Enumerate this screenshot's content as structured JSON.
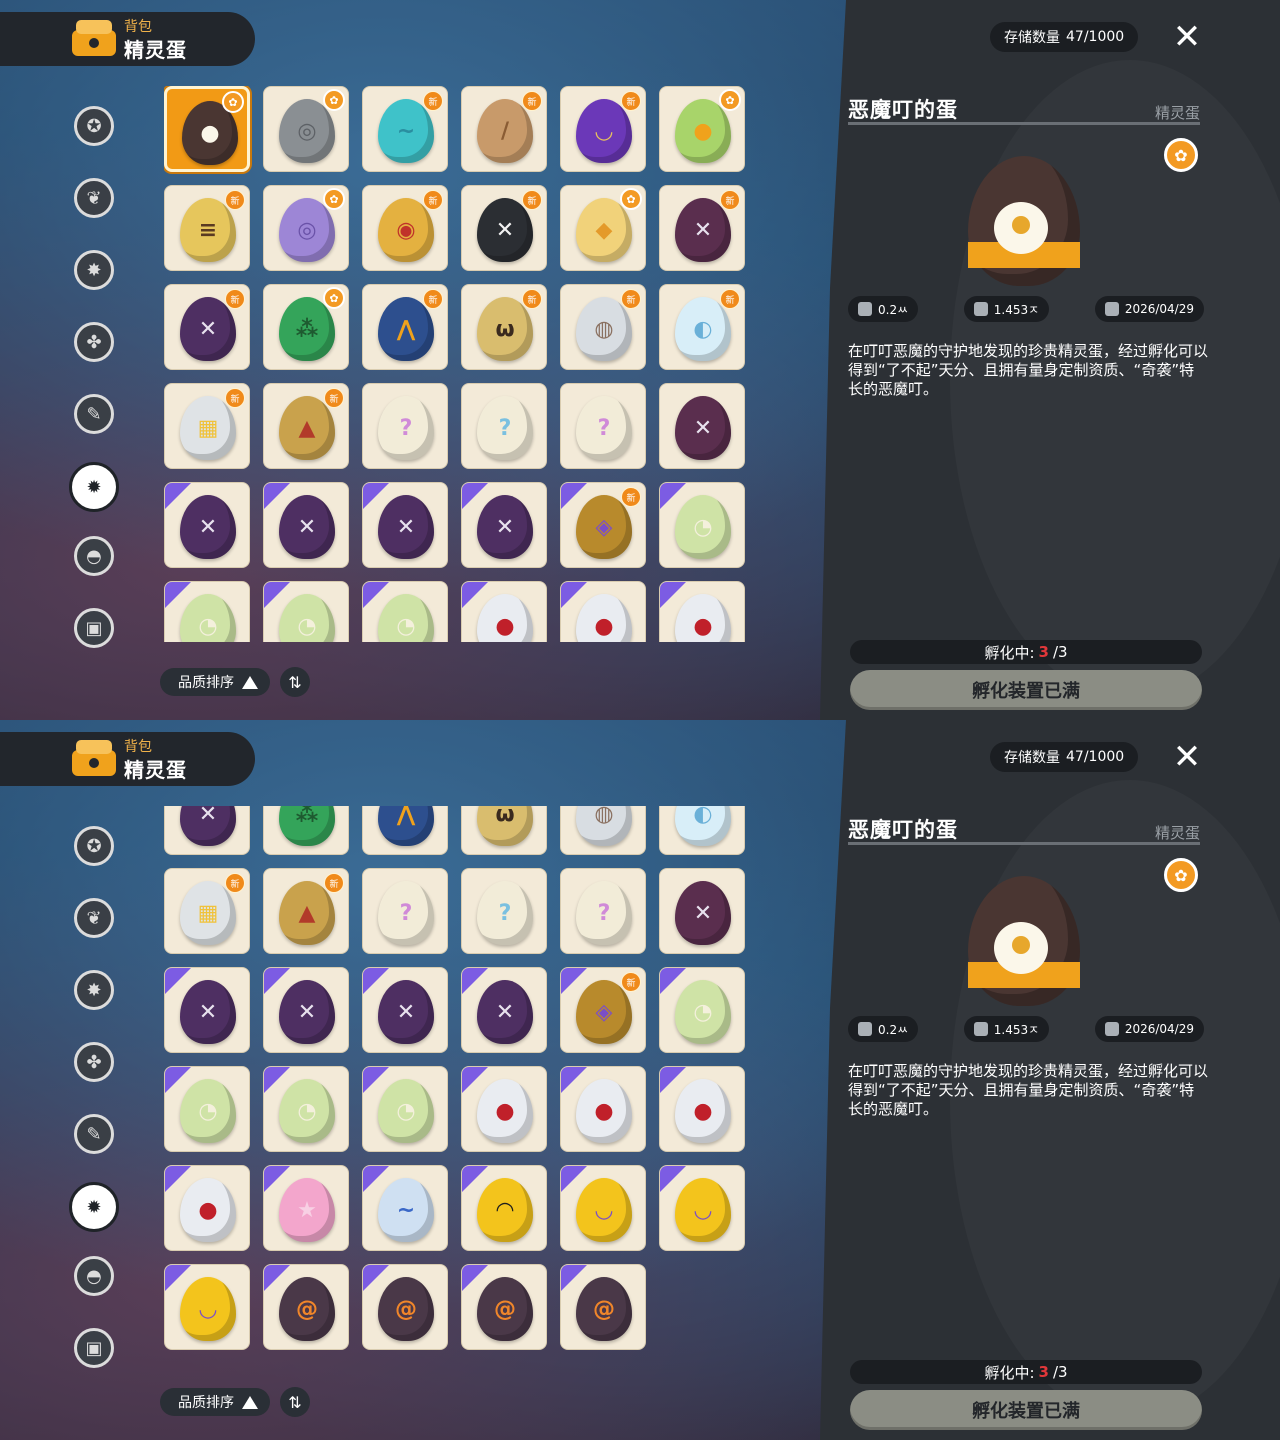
{
  "header": {
    "subtitle": "背包",
    "title": "精灵蛋"
  },
  "sidebar": {
    "icons": [
      "star-icon",
      "leaf-icon",
      "sparkle-icon",
      "bush-icon",
      "document-icon",
      "egg-category-icon",
      "acorn-icon",
      "sofa-icon"
    ],
    "active_index": 5
  },
  "sort": {
    "label": "品质排序",
    "toggle_icon": "⇅"
  },
  "storage": {
    "label": "存储数量",
    "value": "47/1000"
  },
  "detail": {
    "name": "恶魔叮的蛋",
    "category": "精灵蛋",
    "stats": {
      "size": "0.2ㅆ",
      "weight": "1.453ㅈ",
      "date": "2026/04/29"
    },
    "description": "在叮叮恶魔的守护地发现的珍贵精灵蛋，经过孵化可以得到“了不起”天分、且拥有量身定制资质、“奇袭”特长的恶魔叮。",
    "hatching_label": "孵化中:",
    "hatching_current": "3",
    "hatching_total": "/3",
    "hatch_button": "孵化装置已满"
  },
  "badges": {
    "new": "新"
  },
  "colors": {
    "accent": "#f29a15",
    "panel": "#2c3035",
    "card": "#f3ead8",
    "purple_corner": "#7c5ce3",
    "hatch_count": "#e0373a"
  },
  "eggs": [
    {
      "c": "#4a3632",
      "m": "●",
      "mc": "#fbf7ea",
      "badge": "medal",
      "selected": true
    },
    {
      "c": "#8a8f93",
      "m": "◎",
      "mc": "#5d6166",
      "badge": "medal"
    },
    {
      "c": "#3fc2c9",
      "m": "~",
      "mc": "#2a8ea0",
      "badge": "new"
    },
    {
      "c": "#c89a6a",
      "m": "/",
      "mc": "#8a5c34",
      "badge": "new"
    },
    {
      "c": "#6b38b8",
      "m": "◡",
      "mc": "#e8c35c",
      "badge": "new"
    },
    {
      "c": "#a8d46a",
      "m": "●",
      "mc": "#f0a21c",
      "badge": "medal"
    },
    {
      "c": "#e6c65c",
      "m": "≡",
      "mc": "#5a3a22",
      "badge": "new"
    },
    {
      "c": "#9d86d6",
      "m": "◎",
      "mc": "#6a52a8",
      "badge": "medal"
    },
    {
      "c": "#e4b140",
      "m": "◉",
      "mc": "#c0322a",
      "badge": "new"
    },
    {
      "c": "#2b2e33",
      "m": "✕",
      "mc": "#f2f2f2",
      "badge": "new"
    },
    {
      "c": "#f1d27a",
      "m": "◆",
      "mc": "#e49a2a",
      "badge": "medal"
    },
    {
      "c": "#5a2e4e",
      "m": "✕",
      "mc": "#e8e2ee",
      "badge": "new"
    },
    {
      "c": "#4e2f62",
      "m": "✕",
      "mc": "#e8e2ee",
      "badge": "new"
    },
    {
      "c": "#34a45a",
      "m": "⁂",
      "mc": "#1e5a30",
      "badge": "medal"
    },
    {
      "c": "#2d4f8e",
      "m": "⋀",
      "mc": "#f0a21c",
      "badge": "new"
    },
    {
      "c": "#d9bd6e",
      "m": "ω",
      "mc": "#3a2a1e",
      "badge": "new"
    },
    {
      "c": "#d8dde2",
      "m": "◍",
      "mc": "#8a7060",
      "badge": "new"
    },
    {
      "c": "#d8eef8",
      "m": "◐",
      "mc": "#6ab0d8",
      "badge": "new"
    },
    {
      "c": "#dfe3e6",
      "m": "▦",
      "mc": "#f0c23a",
      "badge": "new"
    },
    {
      "c": "#c9a24c",
      "m": "▲",
      "mc": "#b23a2a",
      "badge": "new"
    },
    {
      "c": "#f2ecd8",
      "m": "?",
      "mc": "#d08ad8",
      "badge": ""
    },
    {
      "c": "#f2ecd8",
      "m": "?",
      "mc": "#7ac0e0",
      "badge": ""
    },
    {
      "c": "#f2ecd8",
      "m": "?",
      "mc": "#d08ad8",
      "badge": ""
    },
    {
      "c": "#5a2e4e",
      "m": "✕",
      "mc": "#e8e2ee",
      "badge": ""
    },
    {
      "c": "#4e2f62",
      "m": "✕",
      "mc": "#e8e2ee",
      "badge": "",
      "p": true
    },
    {
      "c": "#4e2f62",
      "m": "✕",
      "mc": "#e8e2ee",
      "badge": "",
      "p": true
    },
    {
      "c": "#4e2f62",
      "m": "✕",
      "mc": "#e8e2ee",
      "badge": "",
      "p": true
    },
    {
      "c": "#4e2f62",
      "m": "✕",
      "mc": "#e8e2ee",
      "badge": "",
      "p": true
    },
    {
      "c": "#b88a2c",
      "m": "◈",
      "mc": "#7a4ec8",
      "badge": "new",
      "p": true
    },
    {
      "c": "#cfe3a6",
      "m": "◔",
      "mc": "#f4f0dc",
      "badge": "",
      "p": true
    },
    {
      "c": "#cfe3a6",
      "m": "◔",
      "mc": "#f4f0dc",
      "badge": "",
      "p": true
    },
    {
      "c": "#cfe3a6",
      "m": "◔",
      "mc": "#f4f0dc",
      "badge": "",
      "p": true
    },
    {
      "c": "#cfe3a6",
      "m": "◔",
      "mc": "#f4f0dc",
      "badge": "",
      "p": true
    },
    {
      "c": "#e9ecf1",
      "m": "●",
      "mc": "#c0202a",
      "badge": "",
      "p": true
    },
    {
      "c": "#e9ecf1",
      "m": "●",
      "mc": "#c0202a",
      "badge": "",
      "p": true
    },
    {
      "c": "#e9ecf1",
      "m": "●",
      "mc": "#c0202a",
      "badge": "",
      "p": true
    },
    {
      "c": "#e9ecf1",
      "m": "●",
      "mc": "#c0202a",
      "badge": "",
      "p": true
    },
    {
      "c": "#f3a6cc",
      "m": "★",
      "mc": "#f8d0e4",
      "badge": "",
      "p": true
    },
    {
      "c": "#cfe0f2",
      "m": "~",
      "mc": "#3a68c8",
      "badge": "",
      "p": true
    },
    {
      "c": "#f3c41c",
      "m": "◠",
      "mc": "#1e1e1e",
      "badge": "",
      "p": true
    },
    {
      "c": "#f3c41c",
      "m": "◡",
      "mc": "#7a4ec8",
      "badge": "",
      "p": true
    },
    {
      "c": "#f3c41c",
      "m": "◡",
      "mc": "#7a4ec8",
      "badge": "",
      "p": true
    },
    {
      "c": "#f3c41c",
      "m": "◡",
      "mc": "#7a4ec8",
      "badge": "",
      "p": true
    },
    {
      "c": "#4a3848",
      "m": "@",
      "mc": "#f0862a",
      "badge": "",
      "p": true
    },
    {
      "c": "#4a3848",
      "m": "@",
      "mc": "#f0862a",
      "badge": "",
      "p": true
    },
    {
      "c": "#4a3848",
      "m": "@",
      "mc": "#f0862a",
      "badge": "",
      "p": true
    },
    {
      "c": "#4a3848",
      "m": "@",
      "mc": "#f0862a",
      "badge": "",
      "p": true
    }
  ],
  "views": [
    {
      "first_row": 0,
      "rows": 6,
      "offset_rows": 0
    },
    {
      "first_row": 2,
      "rows": 6,
      "offset_rows": 0.37
    }
  ]
}
